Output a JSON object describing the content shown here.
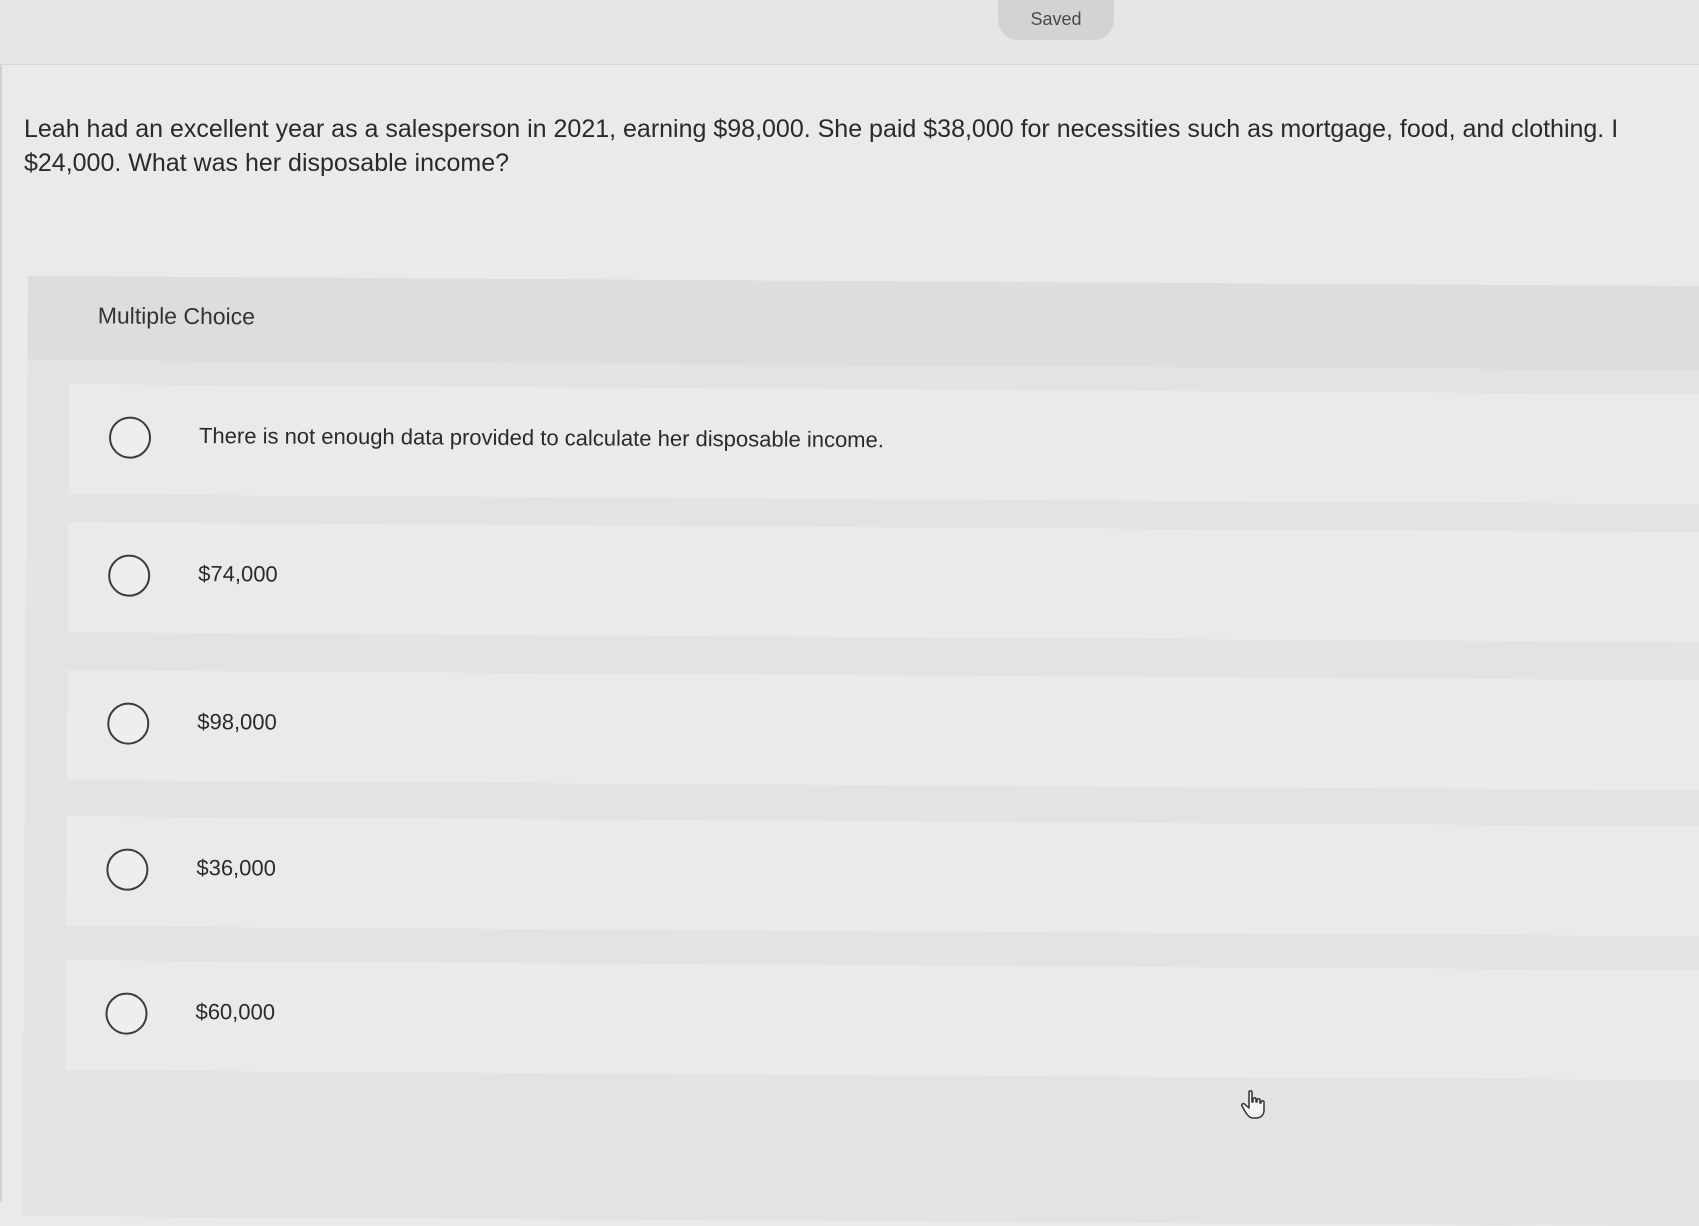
{
  "status": {
    "saved_label": "Saved"
  },
  "question": {
    "text": "Leah had an excellent year as a salesperson in 2021, earning $98,000. She paid $38,000 for necessities such as mortgage, food, and clothing. I\n$24,000. What was her disposable income?"
  },
  "multiple_choice": {
    "title": "Multiple Choice",
    "options": [
      {
        "label": "There is not enough data provided to calculate her disposable income."
      },
      {
        "label": "$74,000"
      },
      {
        "label": "$98,000"
      },
      {
        "label": "$36,000"
      },
      {
        "label": "$60,000"
      }
    ]
  },
  "icons": {
    "cursor": "hand-pointer-icon",
    "radio": "radio-unselected-icon"
  },
  "colors": {
    "background": "#e9eaea",
    "panel": "#e2e3e3",
    "pill": "#d2d3d3",
    "text": "#2a2a2a"
  }
}
